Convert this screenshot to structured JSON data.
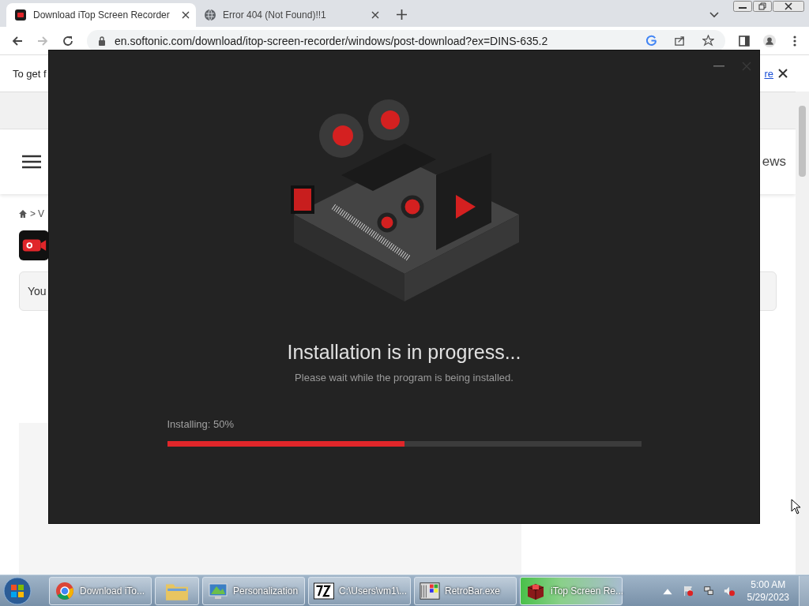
{
  "browser": {
    "tabs": [
      {
        "title": "Download iTop Screen Recorder",
        "selected": true
      },
      {
        "title": "Error 404 (Not Found)!!1",
        "selected": false
      }
    ],
    "url": "en.softonic.com/download/itop-screen-recorder/windows/post-download?ex=DINS-635.2"
  },
  "page": {
    "info_bar": {
      "text": "To get f",
      "link": "re"
    },
    "nav_item": "ews",
    "breadcrumb": [
      ">",
      "V"
    ],
    "card_text": "You"
  },
  "installer": {
    "title": "Installation is in progress...",
    "subtitle": "Please wait while the program is being installed.",
    "progress": {
      "label": "Installing: 50%",
      "level": 0.5
    }
  },
  "taskbar": {
    "items": [
      {
        "kind": "chrome",
        "label": "Download iTo...",
        "selected": false
      },
      {
        "kind": "folder",
        "selected": false
      },
      {
        "kind": "monitor",
        "label": "Personalization",
        "selected": false
      },
      {
        "kind": "sevenzip",
        "label": "C:\\Users\\vm1\\...",
        "selected": false
      },
      {
        "kind": "windows",
        "label": "RetroBar.exe",
        "selected": false
      },
      {
        "kind": "itop",
        "label": "iTop Screen Re...",
        "selected": true
      }
    ],
    "clock": {
      "time": "5:00 AM",
      "date": "5/29/2023"
    }
  }
}
